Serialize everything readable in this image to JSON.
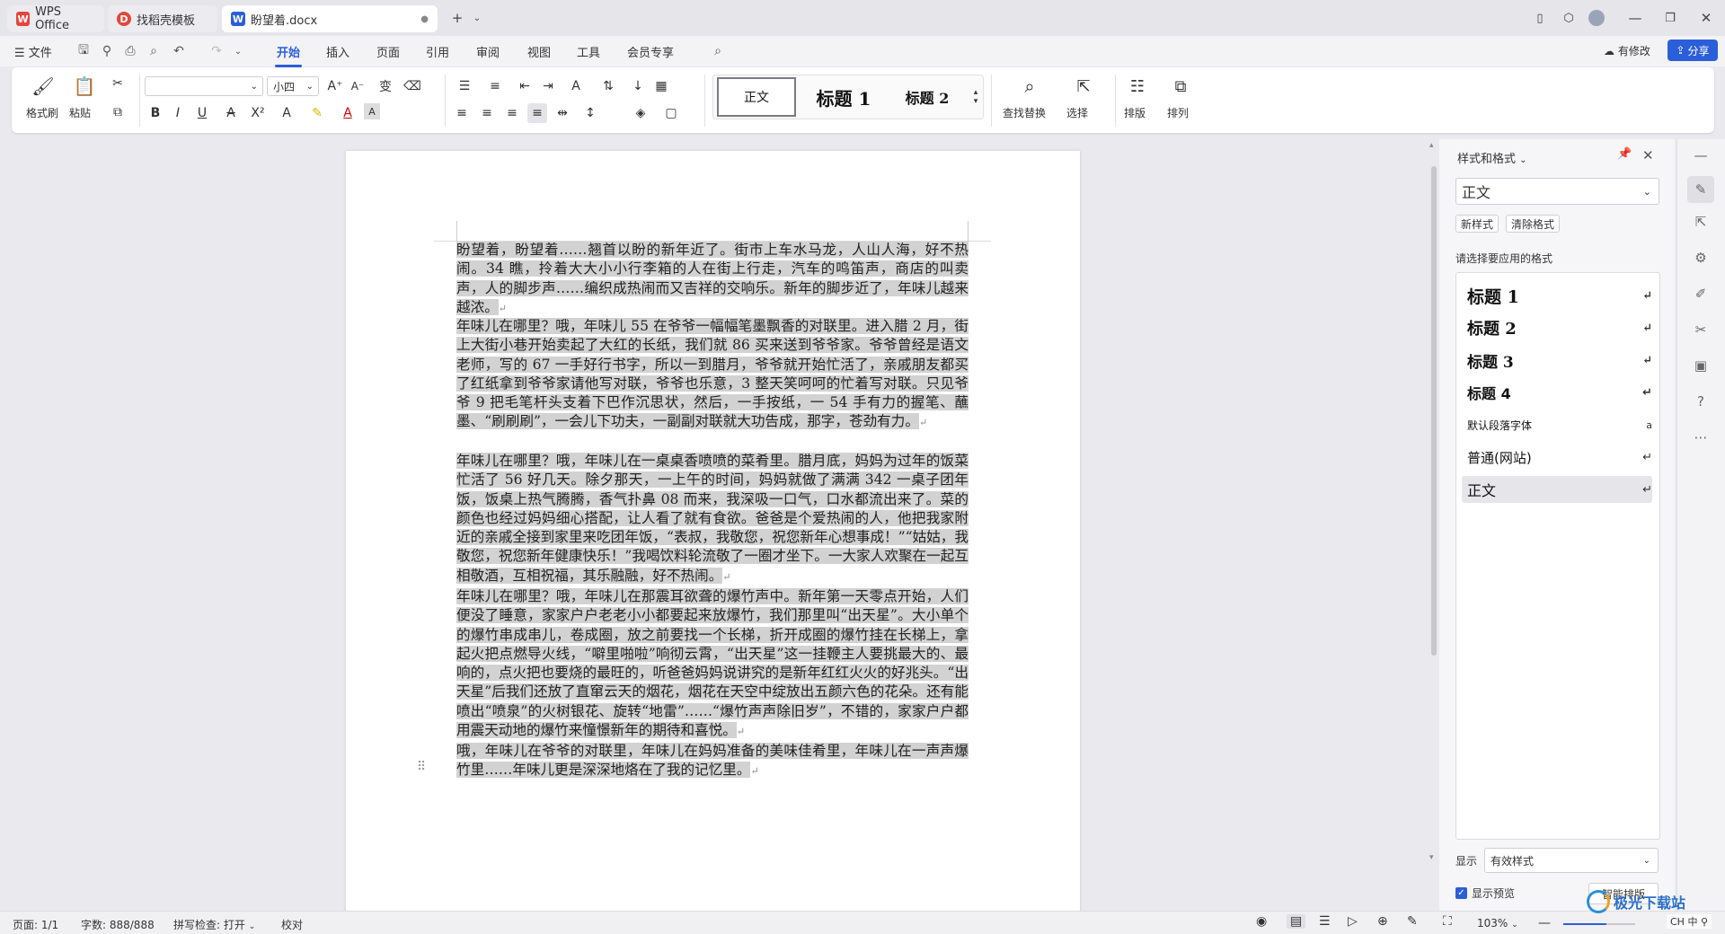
{
  "tabs": [
    {
      "label": "WPS Office",
      "icon": "wps-logo-icon"
    },
    {
      "label": "找稻壳模板",
      "icon": "docer-icon"
    },
    {
      "label": "盼望着.docx",
      "icon": "word-doc-icon",
      "active": true
    }
  ],
  "menubar": {
    "file": "文件",
    "items": [
      "开始",
      "插入",
      "页面",
      "引用",
      "审阅",
      "视图",
      "工具",
      "会员专享"
    ],
    "active": "开始",
    "has_changes": "有修改",
    "share": "分享"
  },
  "ribbon": {
    "format_painter": "格式刷",
    "paste": "粘贴",
    "font_name": "",
    "font_size": "小四",
    "styles": [
      "正文",
      "标题 1",
      "标题 2"
    ],
    "find_replace": "查找替换",
    "select": "选择",
    "layout": "排版",
    "arrange": "排列"
  },
  "document": {
    "paragraphs": [
      "盼望着，盼望着……翘首以盼的新年近了。街市上车水马龙，人山人海，好不热闹。34 瞧，拎着大大小小行李箱的人在街上行走，汽车的鸣笛声，商店的叫卖声，人的脚步声……编织成热闹而又吉祥的交响乐。新年的脚步近了，年味儿越来越浓。",
      "年味儿在哪里？哦，年味儿 55 在爷爷一幅幅笔墨飘香的对联里。进入腊 2 月，街上大街小巷开始卖起了大红的长纸，我们就 86 买来送到爷爷家。爷爷曾经是语文老师，写的 67 一手好行书字，所以一到腊月，爷爷就开始忙活了，亲戚朋友都买了红纸拿到爷爷家请他写对联，爷爷也乐意，3 整天笑呵呵的忙着写对联。只见爷爷 9 把毛笔杆头支着下巴作沉思状，然后，一手按纸，一 54 手有力的握笔、蘸墨、“刷刷刷”，一会儿下功夫，一副副对联就大功告成，那字，苍劲有力。",
      "年味儿在哪里？哦，年味儿在一桌桌香喷喷的菜肴里。腊月底，妈妈为过年的饭菜忙活了 56 好几天。除夕那天，一上午的时间，妈妈就做了满满 342 一桌子团年饭，饭桌上热气腾腾，香气扑鼻 08 而来，我深吸一口气，口水都流出来了。菜的颜色也经过妈妈细心搭配，让人看了就有食欲。爸爸是个爱热闹的人，他把我家附近的亲戚全接到家里来吃团年饭，“表叔，我敬您，祝您新年心想事成！”“姑姑，我敬您，祝您新年健康快乐！”我喝饮料轮流敬了一圈才坐下。一大家人欢聚在一起互相敬酒，互相祝福，其乐融融，好不热闹。",
      "年味儿在哪里？哦，年味儿在那震耳欲聋的爆竹声中。新年第一天零点开始，人们便没了睡意，家家户户老老小小都要起来放爆竹，我们那里叫“出天星”。大小单个的爆竹串成串儿，卷成圈，放之前要找一个长梯，折开成圈的爆竹挂在长梯上，拿起火把点燃导火线，“噼里啪啦”响彻云霄，“出天星”这一挂鞭主人要挑最大的、最响的，点火把也要烧的最旺的，听爸爸妈妈说讲究的是新年红红火火的好兆头。“出天星”后我们还放了直窜云天的烟花，烟花在天空中绽放出五颜六色的花朵。还有能喷出“喷泉”的火树银花、旋转“地雷”……“爆竹声声除旧岁”，不错的，家家户户都用震天动地的爆竹来憧憬新年的期待和喜悦。",
      "哦，年味儿在爷爷的对联里，年味儿在妈妈准备的美味佳肴里，年味儿在一声声爆竹里……年味儿更是深深地烙在了我的记忆里。"
    ]
  },
  "panel": {
    "title": "样式和格式",
    "current_style": "正文",
    "new_style": "新样式",
    "clear_format": "清除格式",
    "apply_hint": "请选择要应用的格式",
    "styles": [
      "标题 1",
      "标题 2",
      "标题 3",
      "标题 4",
      "默认段落字体",
      "普通(网站)",
      "正文"
    ],
    "selected_style": "正文",
    "show_label": "显示",
    "show_value": "有效样式",
    "preview_label": "显示预览",
    "smart_layout": "智能排版",
    "preview_checked": true
  },
  "status": {
    "page": "页面: 1/1",
    "words": "字数: 888/888",
    "spell": "拼写检查: 打开",
    "proof": "校对",
    "zoom": "103%",
    "ime": "CH 中 ⚲",
    "watermark": "极光下载站"
  },
  "colors": {
    "accent": "#2b5fd9",
    "wps_red": "#e7453a",
    "selection": "#d2d2d2"
  }
}
